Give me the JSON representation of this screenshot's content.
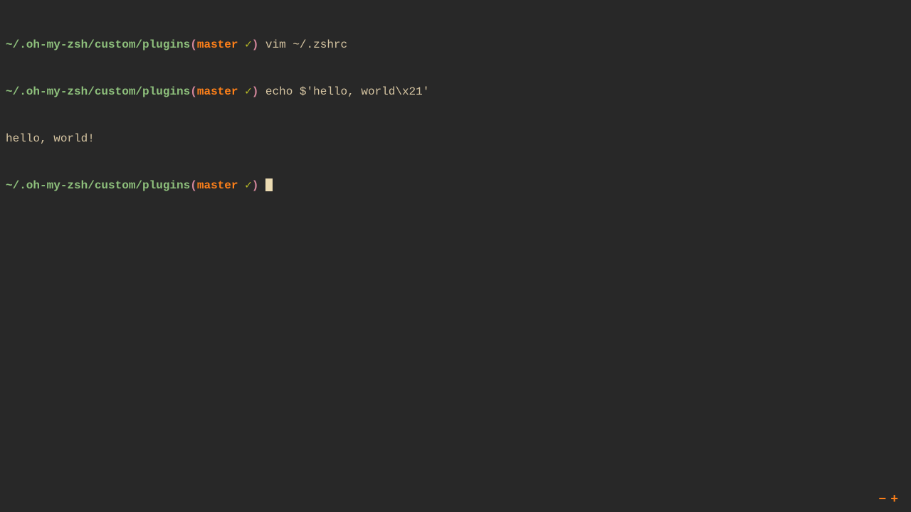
{
  "prompt": {
    "path": "~/.oh-my-zsh/custom/plugins",
    "paren_open": "(",
    "branch": "master",
    "check": " ✓",
    "paren_close": ")"
  },
  "lines": {
    "cmd1": " vim ~/.zshrc",
    "cmd2": " echo $'hello, world\\x21'",
    "output1": "hello, world!",
    "cmd3": " "
  },
  "controls": {
    "minus": "−",
    "plus": "+"
  }
}
